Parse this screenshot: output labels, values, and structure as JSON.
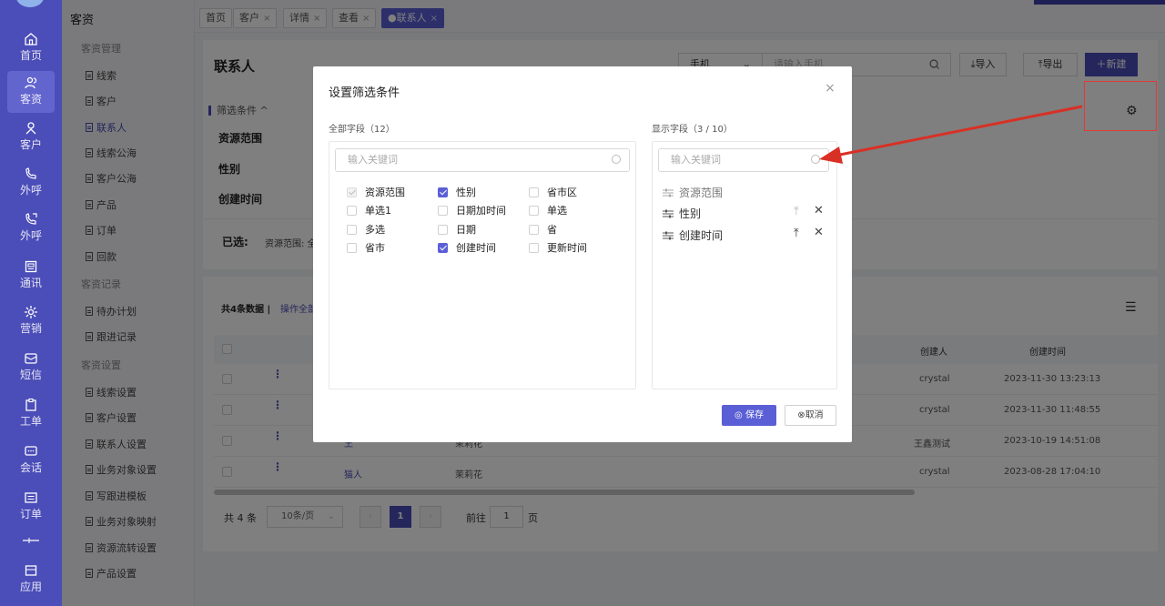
{
  "rail": {
    "items": [
      {
        "label": "首页",
        "icon": "home-icon"
      },
      {
        "label": "客资",
        "icon": "users-icon",
        "active": true
      },
      {
        "label": "客户",
        "icon": "person-icon"
      },
      {
        "label": "外呼",
        "icon": "phone-icon"
      },
      {
        "label": "外呼",
        "icon": "phone-call-icon"
      },
      {
        "label": "通讯",
        "icon": "contacts-icon"
      },
      {
        "label": "营销",
        "icon": "gear-flower-icon"
      },
      {
        "label": "短信",
        "icon": "message-icon"
      },
      {
        "label": "工单",
        "icon": "clipboard-icon"
      },
      {
        "label": "会话",
        "icon": "chat-icon"
      },
      {
        "label": "订单",
        "icon": "order-icon"
      },
      {
        "label": "",
        "icon": "divider-icon"
      },
      {
        "label": "应用",
        "icon": "app-icon"
      }
    ]
  },
  "subnav": {
    "title": "客资",
    "groups": [
      "客资管理",
      "客资记录",
      "客资设置"
    ],
    "items": [
      "线索",
      "客户",
      "联系人",
      "线索公海",
      "客户公海",
      "产品",
      "订单",
      "回款",
      "待办计划",
      "跟进记录",
      "线索设置",
      "客户设置",
      "联系人设置",
      "业务对象设置",
      "写跟进模板",
      "业务对象映射",
      "资源流转设置",
      "产品设置"
    ],
    "active": "联系人"
  },
  "tabs": [
    {
      "label": "首页",
      "closable": false
    },
    {
      "label": "客户",
      "closable": true
    },
    {
      "label": "详情",
      "closable": true
    },
    {
      "label": "查看",
      "closable": true
    },
    {
      "label": "●联系人",
      "closable": true,
      "active": true
    }
  ],
  "tab_close": "×",
  "page": {
    "title": "联系人",
    "search_select": "手机",
    "search_placeholder": "请输入手机",
    "import_label": "导入",
    "export_label": "导出",
    "new_label": "新建",
    "filter_toggle": "筛选条件 ^",
    "filter_fields": [
      "资源范围",
      "性别",
      "创建时间"
    ],
    "selected_label": "已选:",
    "selected_value": "资源范围: 全"
  },
  "list": {
    "count_text": "共4条数据",
    "separator": "|",
    "operation": "操作全部",
    "columns": {
      "creator": "创建人",
      "created": "创建时间"
    },
    "rows": [
      {
        "name": "",
        "flower": "",
        "creator": "crystal",
        "created": "2023-11-30 13:23:13"
      },
      {
        "name": "",
        "flower": "",
        "creator": "crystal",
        "created": "2023-11-30 11:48:55"
      },
      {
        "name": "王",
        "flower": "茉莉花",
        "creator": "王鑫测试",
        "created": "2023-10-19 14:51:08"
      },
      {
        "name": "猫人",
        "flower": "茉莉花",
        "creator": "crystal",
        "created": "2023-08-28 17:04:10"
      }
    ],
    "total_text": "共 4 条",
    "page_size": "10条/页",
    "current_page": "1",
    "goto_label": "前往",
    "goto_value": "1",
    "page_suffix": "页"
  },
  "modal": {
    "title": "设置筛选条件",
    "close": "×",
    "all_fields_label": "全部字段（12）",
    "display_fields_label": "显示字段（3 / 10）",
    "keyword_placeholder": "输入关键词",
    "options": [
      {
        "label": "资源范围",
        "state": "disabled"
      },
      {
        "label": "性别",
        "state": "checked"
      },
      {
        "label": "省市区",
        "state": "unchecked"
      },
      {
        "label": "单选1",
        "state": "unchecked"
      },
      {
        "label": "日期加时间",
        "state": "unchecked"
      },
      {
        "label": "单选",
        "state": "unchecked"
      },
      {
        "label": "多选",
        "state": "unchecked"
      },
      {
        "label": "日期",
        "state": "unchecked"
      },
      {
        "label": "省",
        "state": "unchecked"
      },
      {
        "label": "省市",
        "state": "unchecked"
      },
      {
        "label": "创建时间",
        "state": "checked"
      },
      {
        "label": "更新时间",
        "state": "unchecked"
      }
    ],
    "display": [
      {
        "label": "资源范围",
        "fixed": true
      },
      {
        "label": "性别",
        "fixed": false
      },
      {
        "label": "创建时间",
        "fixed": false
      }
    ],
    "save_label": "保存",
    "cancel_label": "取消"
  },
  "colors": {
    "primary": "#4b4db8",
    "accent": "#5b5fd6",
    "annotation": "#e53935"
  }
}
